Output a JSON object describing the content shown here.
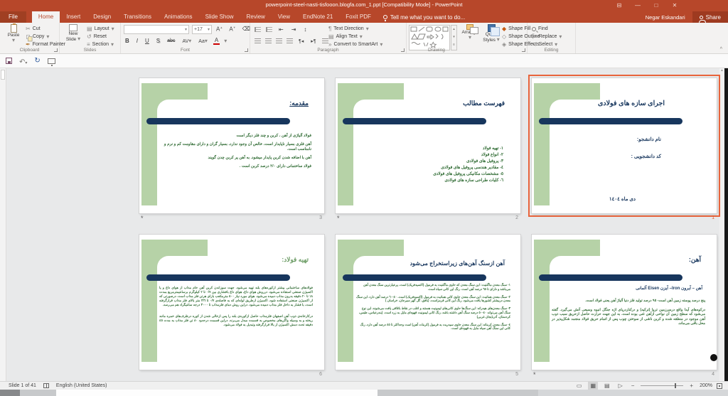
{
  "window": {
    "title": "powerpoint-steel-nasti-tisfooon.blogfa.com_1.ppt [Compatibility Mode] - PowerPoint"
  },
  "account": {
    "user": "Negar Eskandari",
    "share": "Share"
  },
  "tabs": {
    "file": "File",
    "items": [
      "Home",
      "Insert",
      "Design",
      "Transitions",
      "Animations",
      "Slide Show",
      "Review",
      "View",
      "EndNote 21",
      "Foxit PDF"
    ],
    "active": "Home",
    "tell_me": "Tell me what you want to do..."
  },
  "ribbon": {
    "clipboard": {
      "label": "Clipboard",
      "paste": "Paste",
      "cut": "Cut",
      "copy": "Copy",
      "format_painter": "Format Painter"
    },
    "slides_group": {
      "label": "Slides",
      "new_slide_1": "New",
      "new_slide_2": "Slide",
      "layout": "Layout",
      "reset": "Reset",
      "section": "Section"
    },
    "font": {
      "label": "Font",
      "font_name": "",
      "size": "+17",
      "bold": "B",
      "italic": "I",
      "underline": "U",
      "shadow": "S",
      "strike": "abc",
      "spacing": "AV",
      "case": "Aa",
      "color": "A",
      "grow": "A",
      "shrink": "A"
    },
    "paragraph": {
      "label": "Paragraph",
      "text_direction": "Text Direction",
      "align_text": "Align Text",
      "convert": "Convert to SmartArt"
    },
    "drawing": {
      "label": "Drawing",
      "arrange": "Arrange",
      "quick_1": "Quick",
      "quick_2": "Styles",
      "shape_fill": "Shape Fill",
      "shape_outline": "Shape Outline",
      "shape_effects": "Shape Effects"
    },
    "editing": {
      "label": "Editing",
      "find": "Find",
      "replace": "Replace",
      "select": "Select"
    }
  },
  "slides": [
    {
      "number": "3",
      "star": "*",
      "title": "مقدمه:",
      "paragraphs": [
        "فولاد آلیاژی از آهن ، کربن و چند فلز دیگر است",
        "آهن فلزی بسیار ناپایدار است، خالص آن وجود ندارد، بسیار گران و دارای مقاومت کم و نرم و نامناسب است.",
        "آهن با اضافه شدن کربن پایدار میشود. به آهن پر کربن چدن گویند",
        "فولاد ساختمانی دارای ٢/٠ درصد کربن است ."
      ]
    },
    {
      "number": "2",
      "star": "*",
      "title": "فهرست مطالب",
      "items": [
        "١- تهیه فولاد",
        "٢- انواع فولاد",
        "٣- پروفیل های فولادی",
        "٤- مقادیر هندسی پروفیل های فولادی",
        "٥- مشخصات مکانیکی پروفیل های فولادی",
        "٦- کلیات طراحی سازه های فولادی"
      ]
    },
    {
      "number": "1",
      "star": "",
      "title": "اجرای سازه های فولادی",
      "line1": "نام دانشجو:",
      "line2": "کد دانشجویی :",
      "date": "دی ماه ١٤٠٤"
    },
    {
      "number": "6",
      "star": "",
      "title": "تهیه فولاد:",
      "paragraphs": [
        "فولادهای ساختمانی بیشتر ازکوره‌های بلند تهیه می‌شود. جهت سوزاندن کربن آهن خام مذاب از هوای داغ و یا اکسیژن صنعتی استفاده می‌شود. درروش هوای داغ، هوای داغ بافشاری بین ٠/٧ تا ٢ کیلوگرم برسانتیمترمربع بمدت ١٨ تا ٢٠ دقیقه بدرون مذاب دمیده می‌شود. هوای مورد نیاز ٥٠٠ مترمکعب بازای هرتن فلز مذاب است. درصورتی که از اکسیژن صنعتی استفاده شود، اکسیژن ازطریق لوله‌ای که به فاصله‌ی ٠/٧ تا ٣/٦ متر بالای فلز مذاب قرارگرفته است، با فشار به داخل فلز مذاب دمیده می‌شود. دراین روش دمای فلزمذاب تا ٣٠٠٠ درجه سانتیگراد هم می‌رسد.",
        "درکارخانه‌ی ذوب آهن اصفهان فلزمذاب حاصل ازکوره‌ی بلند را پس ازخالی شدن از کوره درظرف‌های خمره مانند ریخته و به وسیله واگن‌های مخصوص به قسمت مبدل می‌برند. دراین قسمت درحدود ٨٠ تن فلز مذاب به مدت ٤٥ دقیقه تحت دمش اکسیژن از بالا قرارگرفته وتبدیل به فولاد می‌شود."
      ]
    },
    {
      "number": "5",
      "star": "",
      "title": "آهن ازسنگ آهن‌های زیراستخراج می‌شود",
      "paragraphs": [
        "١- سنگ معدن ماگنتیت: این سنگ معدن که حاوی ماگنتیت به فرمول (اکسیدفریک) است، پرعیارترین سنگ معدن آهن می‌باشد و دارای تا ٦٥ درصد آهن است. رنگ این کانی سیاه است.",
        "٢- سنگ معدن هماتیت: این سنگ معدن حاوی کانی هماتیت به فرمول (اکسیدفریک) است. ٤٠-٦٠ درصد آهن دارد. این سنگ معدن دربیشتر کشورها یافت می‌شود. رنگ این کانی قرمزاست. (بافق، گل گهر سیرجان، خراسان )",
        "٣- سنگ معدن‌های هیدراته: این سنگ‌ها حاوی کانی‌های لیمونیت هستند و اغلب در نقاط باتلاقی یافت می‌شوند. این نوع سنگ آهن می‌تواند ٤٠-٥٠ درصد سنگ آهن داشته باشد. رنگ کانی لیمونیت قهوه‌ای مایل به زرد است. (بندرعباس، طبس، کردستان، آذربایجان غربی)",
        "٤- سنگ معدن کربناته: این سنگ معدن حاوی سیدریت به فرمول (کربنات آهن) است وحداکثر تا ٤٥ درصد آهن دارد. رنگ کانی این سنگ آهن سیاه مایل به قهوه‌ای است."
      ]
    },
    {
      "number": "4",
      "star": "*",
      "title": "آهن:",
      "subtitle": "آهن – آیرون Iron– آیزن Eisen آلمانی",
      "paragraphs": [
        "پنج درصد پوسته زمین آهن است- ٩٥ درصد تولید فلز دنیا آلیاژ آهن یعنی فولاد است.",
        "درکوه‌های آیدا واقع درسرزمین تروا (ترکیه) و درکناردریای اژه جنگل انبوه وسیعی آتش می‌گیرد. گفته می‌شود که سطح زمین آن نواحی ازآهن غنی بوده است. به این جهت حرارت حاصل ازحریق سبب ذوب آهن موجود در منطقه شده و کربن ناشی از سوختن چوب پس از اتمام حریق فولاد منجمد شکل‌پذیر در محل باقی می‌ماند."
      ]
    }
  ],
  "status": {
    "slide_counter": "Slide 1 of 41",
    "language": "English (United States)",
    "zoom_level": "200%"
  },
  "icons": {
    "minimize": "—",
    "maximize": "□",
    "close": "✕",
    "ribbon_display": "⊟",
    "undo": "↶",
    "redo": "↻",
    "dropdown": "▾",
    "collapse_ribbon": "^",
    "cut": "✂",
    "format_painter": "✒",
    "layout": "▤",
    "reset": "↺",
    "section": "≡",
    "grow_sup": "▲",
    "shrink_sup": "▼",
    "clear_fmt": "⌫",
    "numbering": "№",
    "bullets": "•",
    "indent_less": "⇤",
    "indent_more": "⇥",
    "spacing": "↕",
    "pilcrow_left": "¶◂",
    "pilcrow_right": "▸¶",
    "textdir": "¶",
    "aligntext": "▤",
    "smartart": "»",
    "shape_fill": "◆",
    "shape_outline": "◇",
    "shape_effects": "◈",
    "replace": "⇄",
    "select": "↖",
    "scroll_up": "▴",
    "scroll_dn": "▾",
    "gallery_more": "≡",
    "view_normal": "▭",
    "view_sorter": "▦",
    "view_reading": "▤",
    "view_show": "▷",
    "zoom_minus": "−",
    "zoom_plus": "+"
  },
  "colors": {
    "titlebar_red": "#b7472a",
    "accent_green": "#b6d2a7",
    "navy": "#17365d",
    "body_green": "#2f6b33",
    "slide6_title_green": "#6f9e68",
    "selection_orange": "#e8643c"
  }
}
